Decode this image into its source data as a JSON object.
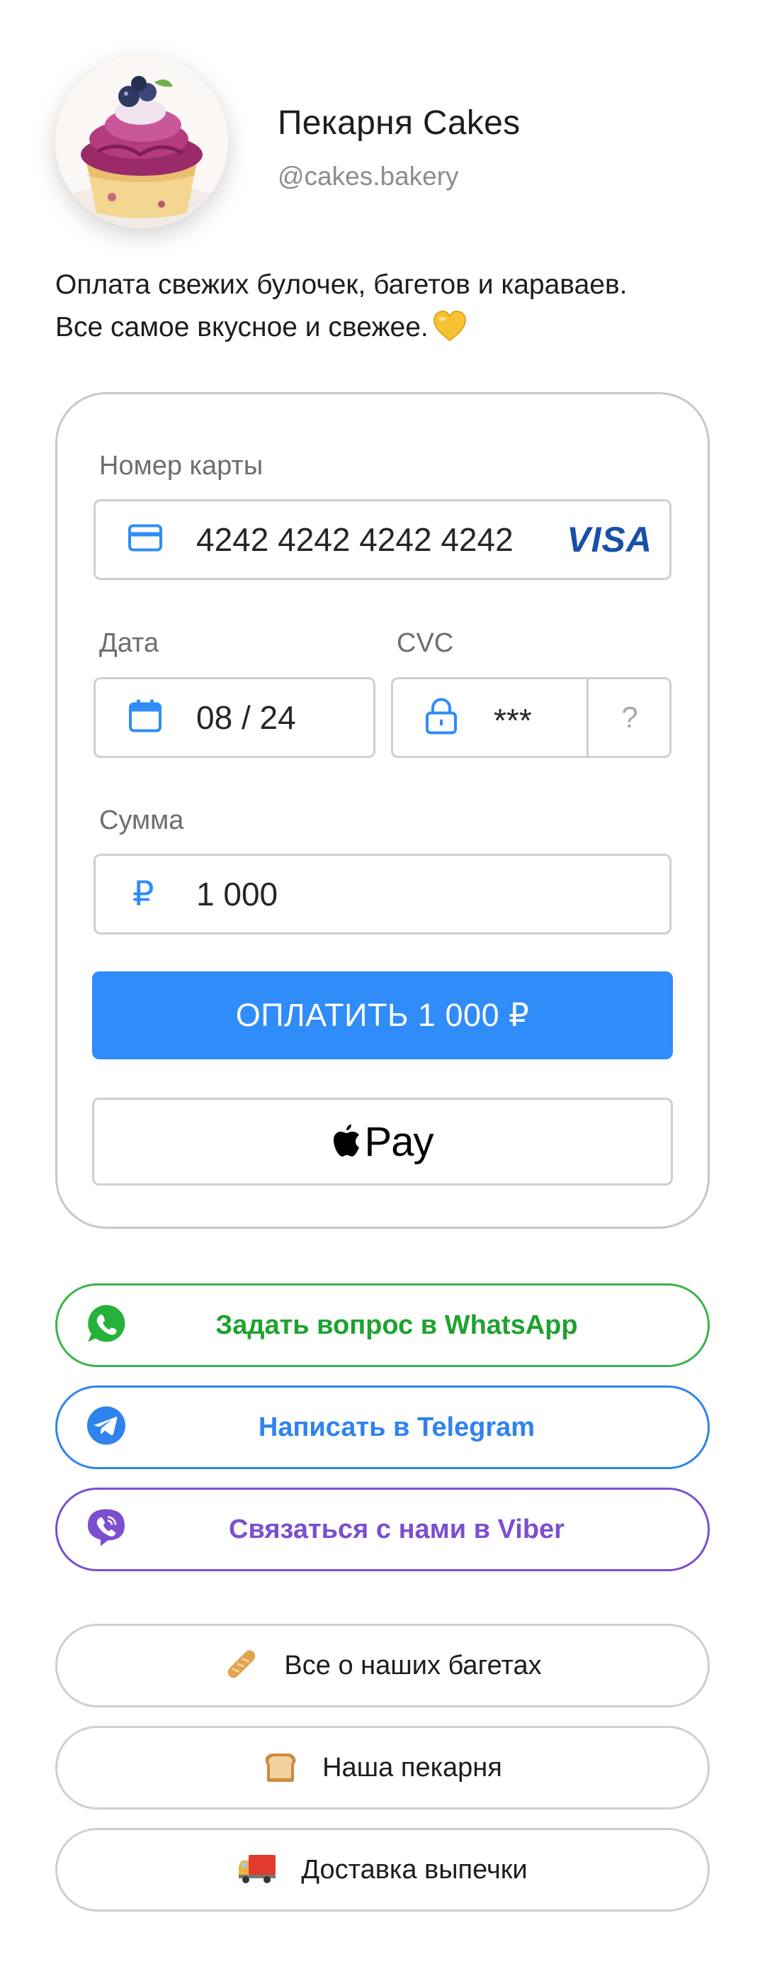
{
  "profile": {
    "name": "Пекарня Cakes",
    "handle": "@cakes.bakery",
    "bio_line1": "Оплата свежих булочек, багетов и караваев.",
    "bio_line2": "Все самое вкусное и свежее."
  },
  "payment_form": {
    "card_label": "Номер карты",
    "card_number": "4242 4242 4242 4242",
    "card_brand": "VISA",
    "date_label": "Дата",
    "date_value": "08 / 24",
    "cvc_label": "CVC",
    "cvc_value": "***",
    "cvc_help": "?",
    "amount_label": "Сумма",
    "currency_symbol": "₽",
    "amount_value": "1 000",
    "pay_button": "ОПЛАТИТЬ 1 000 ₽",
    "apple_pay_label": "Pay"
  },
  "messengers": [
    {
      "label": "Задать вопрос в WhatsApp",
      "icon": "whatsapp-icon",
      "color": "#1fa22e"
    },
    {
      "label": "Написать в Telegram",
      "icon": "telegram-icon",
      "color": "#2f83ec"
    },
    {
      "label": "Связаться с нами в Viber",
      "icon": "viber-icon",
      "color": "#7b4fd0"
    }
  ],
  "links": [
    {
      "label": "Все о наших багетах",
      "icon": "baguette-icon"
    },
    {
      "label": "Наша пекарня",
      "icon": "bread-icon"
    },
    {
      "label": "Доставка выпечки",
      "icon": "truck-icon"
    }
  ],
  "colors": {
    "accent": "#2f8cf8",
    "visa_blue": "#1a4fa8",
    "field_border": "#cfcfcf"
  }
}
